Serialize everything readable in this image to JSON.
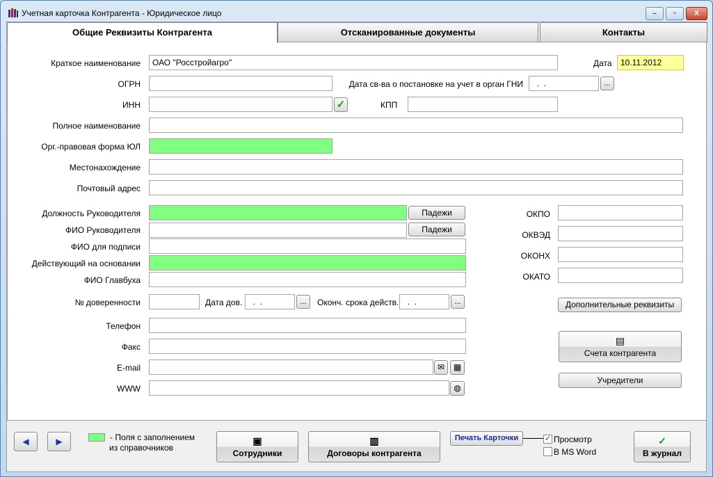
{
  "window": {
    "title": "Учетная карточка Контрагента - Юридическое лицо",
    "minimize": "‒",
    "maximize": "▫",
    "close": "X"
  },
  "tabs": [
    {
      "label": "Общие Реквизиты Контрагента",
      "active": true
    },
    {
      "label": "Отсканированные документы"
    },
    {
      "label": "Контакты"
    }
  ],
  "form": {
    "short_name": {
      "label": "Краткое наименование",
      "value": "ОАО \"Росстройагро\""
    },
    "date": {
      "label": "Дата",
      "value": "10.11.2012"
    },
    "ogrn": {
      "label": "ОГРН",
      "value": ""
    },
    "gni_date": {
      "label": "Дата св-ва о постановке на учет в орган ГНИ",
      "value": "  .  ."
    },
    "inn": {
      "label": "ИНН",
      "value": ""
    },
    "kpp": {
      "label": "КПП",
      "value": ""
    },
    "full_name": {
      "label": "Полное наименование",
      "value": ""
    },
    "org_form": {
      "label": "Орг.-правовая форма ЮЛ",
      "value": ""
    },
    "location": {
      "label": "Местонахождение",
      "value": ""
    },
    "postal": {
      "label": "Почтовый адрес",
      "value": ""
    },
    "head_position": {
      "label": "Должность Руководителя",
      "value": ""
    },
    "head_name": {
      "label": "ФИО Руководителя",
      "value": ""
    },
    "sign_name": {
      "label": "ФИО для подписи",
      "value": ""
    },
    "basis": {
      "label": "Действующий на основании",
      "value": ""
    },
    "accountant": {
      "label": "ФИО Главбуха",
      "value": ""
    },
    "poa_number": {
      "label": "№ доверенности",
      "value": ""
    },
    "poa_date": {
      "label": "Дата дов.",
      "value": "  .  ."
    },
    "poa_end": {
      "label": "Оконч. срока действ.",
      "value": "  .  ."
    },
    "phone": {
      "label": "Телефон",
      "value": ""
    },
    "fax": {
      "label": "Факс",
      "value": ""
    },
    "email": {
      "label": "E-mail",
      "value": ""
    },
    "www": {
      "label": "WWW",
      "value": ""
    },
    "okpo": {
      "label": "ОКПО",
      "value": ""
    },
    "okved": {
      "label": "ОКВЭД",
      "value": ""
    },
    "okonh": {
      "label": "ОКОНХ",
      "value": ""
    },
    "okato": {
      "label": "ОКАТО",
      "value": ""
    },
    "cases_label": "Падежи",
    "dots_label": "...",
    "check_icon": "✓",
    "extra_button": "Дополнительные реквизиты",
    "accounts_button": "Счета контрагента",
    "founders_button": "Учредители"
  },
  "footer": {
    "prev": "◀",
    "next": "▶",
    "legend_line1": "-  Поля с заполнением",
    "legend_line2": "из справочников",
    "employees_button": "Сотрудники",
    "contracts_button": "Договоры контрагента",
    "print_button": "Печать Карточки",
    "preview": {
      "label": "Просмотр",
      "checked": true
    },
    "msword": {
      "label": "В MS Word",
      "checked": false
    },
    "journal_button": "В журнал"
  },
  "colors": {
    "lookup_field": "#80ff80",
    "date_field": "#ffff99",
    "accent_check": "#1a9a1a"
  }
}
